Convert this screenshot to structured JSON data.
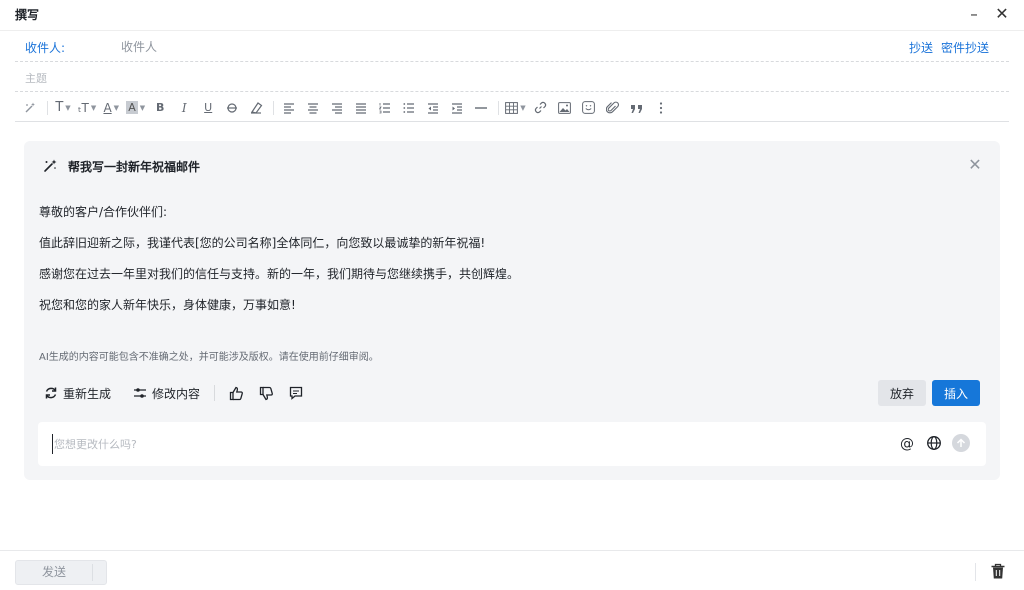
{
  "window": {
    "title": "撰写",
    "minimize": "–",
    "close": "✕"
  },
  "compose": {
    "to_label": "收件人:",
    "to_placeholder": "收件人",
    "cc_label": "抄送",
    "bcc_label": "密件抄送",
    "subject_placeholder": "主题"
  },
  "toolbar": {
    "icons": [
      "ai-pen-icon",
      "font-family-icon",
      "font-size-icon",
      "font-color-icon",
      "highlight-color-icon",
      "bold-icon",
      "italic-icon",
      "underline-icon",
      "strikethrough-icon",
      "clear-format-icon",
      "align-left-icon",
      "align-center-icon",
      "align-right-icon",
      "align-justify-icon",
      "ordered-list-icon",
      "unordered-list-icon",
      "outdent-icon",
      "indent-icon",
      "horizontal-rule-icon",
      "table-icon",
      "link-icon",
      "image-icon",
      "emoji-icon",
      "attachment-icon",
      "quote-icon",
      "more-icon"
    ],
    "bold": "B",
    "italic": "I",
    "underline": "U",
    "font": "T",
    "font_size": "ₜT",
    "font_color": "A",
    "highlight": "A"
  },
  "ai_panel": {
    "title": "帮我写一封新年祝福邮件",
    "body": [
      "尊敬的客户/合作伙伴们:",
      "值此辞旧迎新之际，我谨代表[您的公司名称]全体同仁，向您致以最诚挚的新年祝福!",
      "感谢您在过去一年里对我们的信任与支持。新的一年，我们期待与您继续携手，共创辉煌。",
      "祝您和您的家人新年快乐，身体健康，万事如意!"
    ],
    "disclaimer": "AI生成的内容可能包含不准确之处，并可能涉及版权。请在使用前仔细审阅。",
    "regenerate": "重新生成",
    "modify": "修改内容",
    "discard": "放弃",
    "insert": "插入",
    "input_placeholder": "您想更改什么吗?",
    "at_symbol": "@"
  },
  "footer": {
    "send": "发送"
  },
  "colors": {
    "accent": "#1677d9",
    "link": "#1a73d9",
    "panel_bg": "#f4f5f7"
  }
}
